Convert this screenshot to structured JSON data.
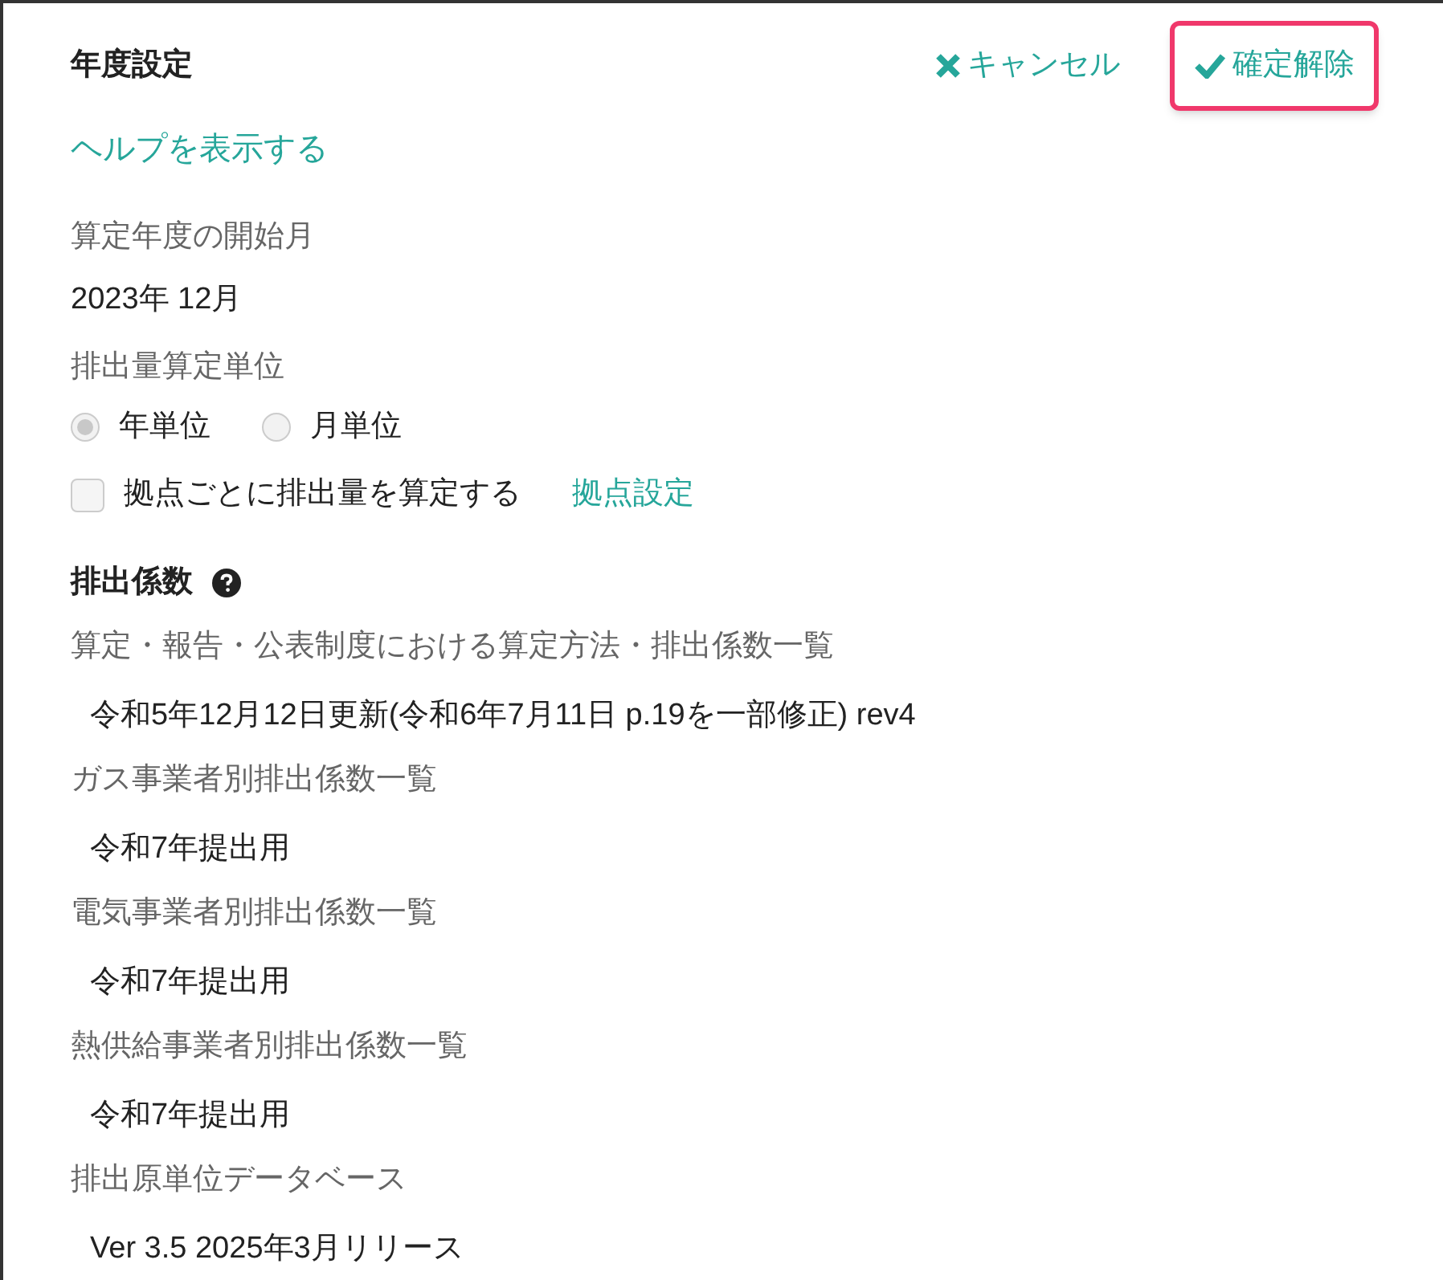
{
  "title": "年度設定",
  "actions": [
    {
      "kind": "cancel",
      "label": "キャンセル",
      "highlighted": false
    },
    {
      "kind": "confirm",
      "label": "確定解除",
      "highlighted": true
    }
  ],
  "help_link": "ヘルプを表示する",
  "start_month": {
    "label": "算定年度の開始月",
    "value": "2023年 12月"
  },
  "unit": {
    "label": "排出量算定単位",
    "options": [
      {
        "label": "年単位",
        "selected": true
      },
      {
        "label": "月単位",
        "selected": false
      }
    ]
  },
  "per_site": {
    "label": "拠点ごとに排出量を算定する",
    "checked": false,
    "link": "拠点設定"
  },
  "factors": {
    "heading": "排出係数",
    "items": [
      {
        "label": "算定・報告・公表制度における算定方法・排出係数一覧",
        "value": "令和5年12月12日更新(令和6年7月11日 p.19を一部修正) rev4"
      },
      {
        "label": "ガス事業者別排出係数一覧",
        "value": "令和7年提出用"
      },
      {
        "label": "電気事業者別排出係数一覧",
        "value": "令和7年提出用"
      },
      {
        "label": "熱供給事業者別排出係数一覧",
        "value": "令和7年提出用"
      },
      {
        "label": "排出原単位データベース",
        "value": "Ver 3.5 2025年3月リリース"
      }
    ]
  }
}
